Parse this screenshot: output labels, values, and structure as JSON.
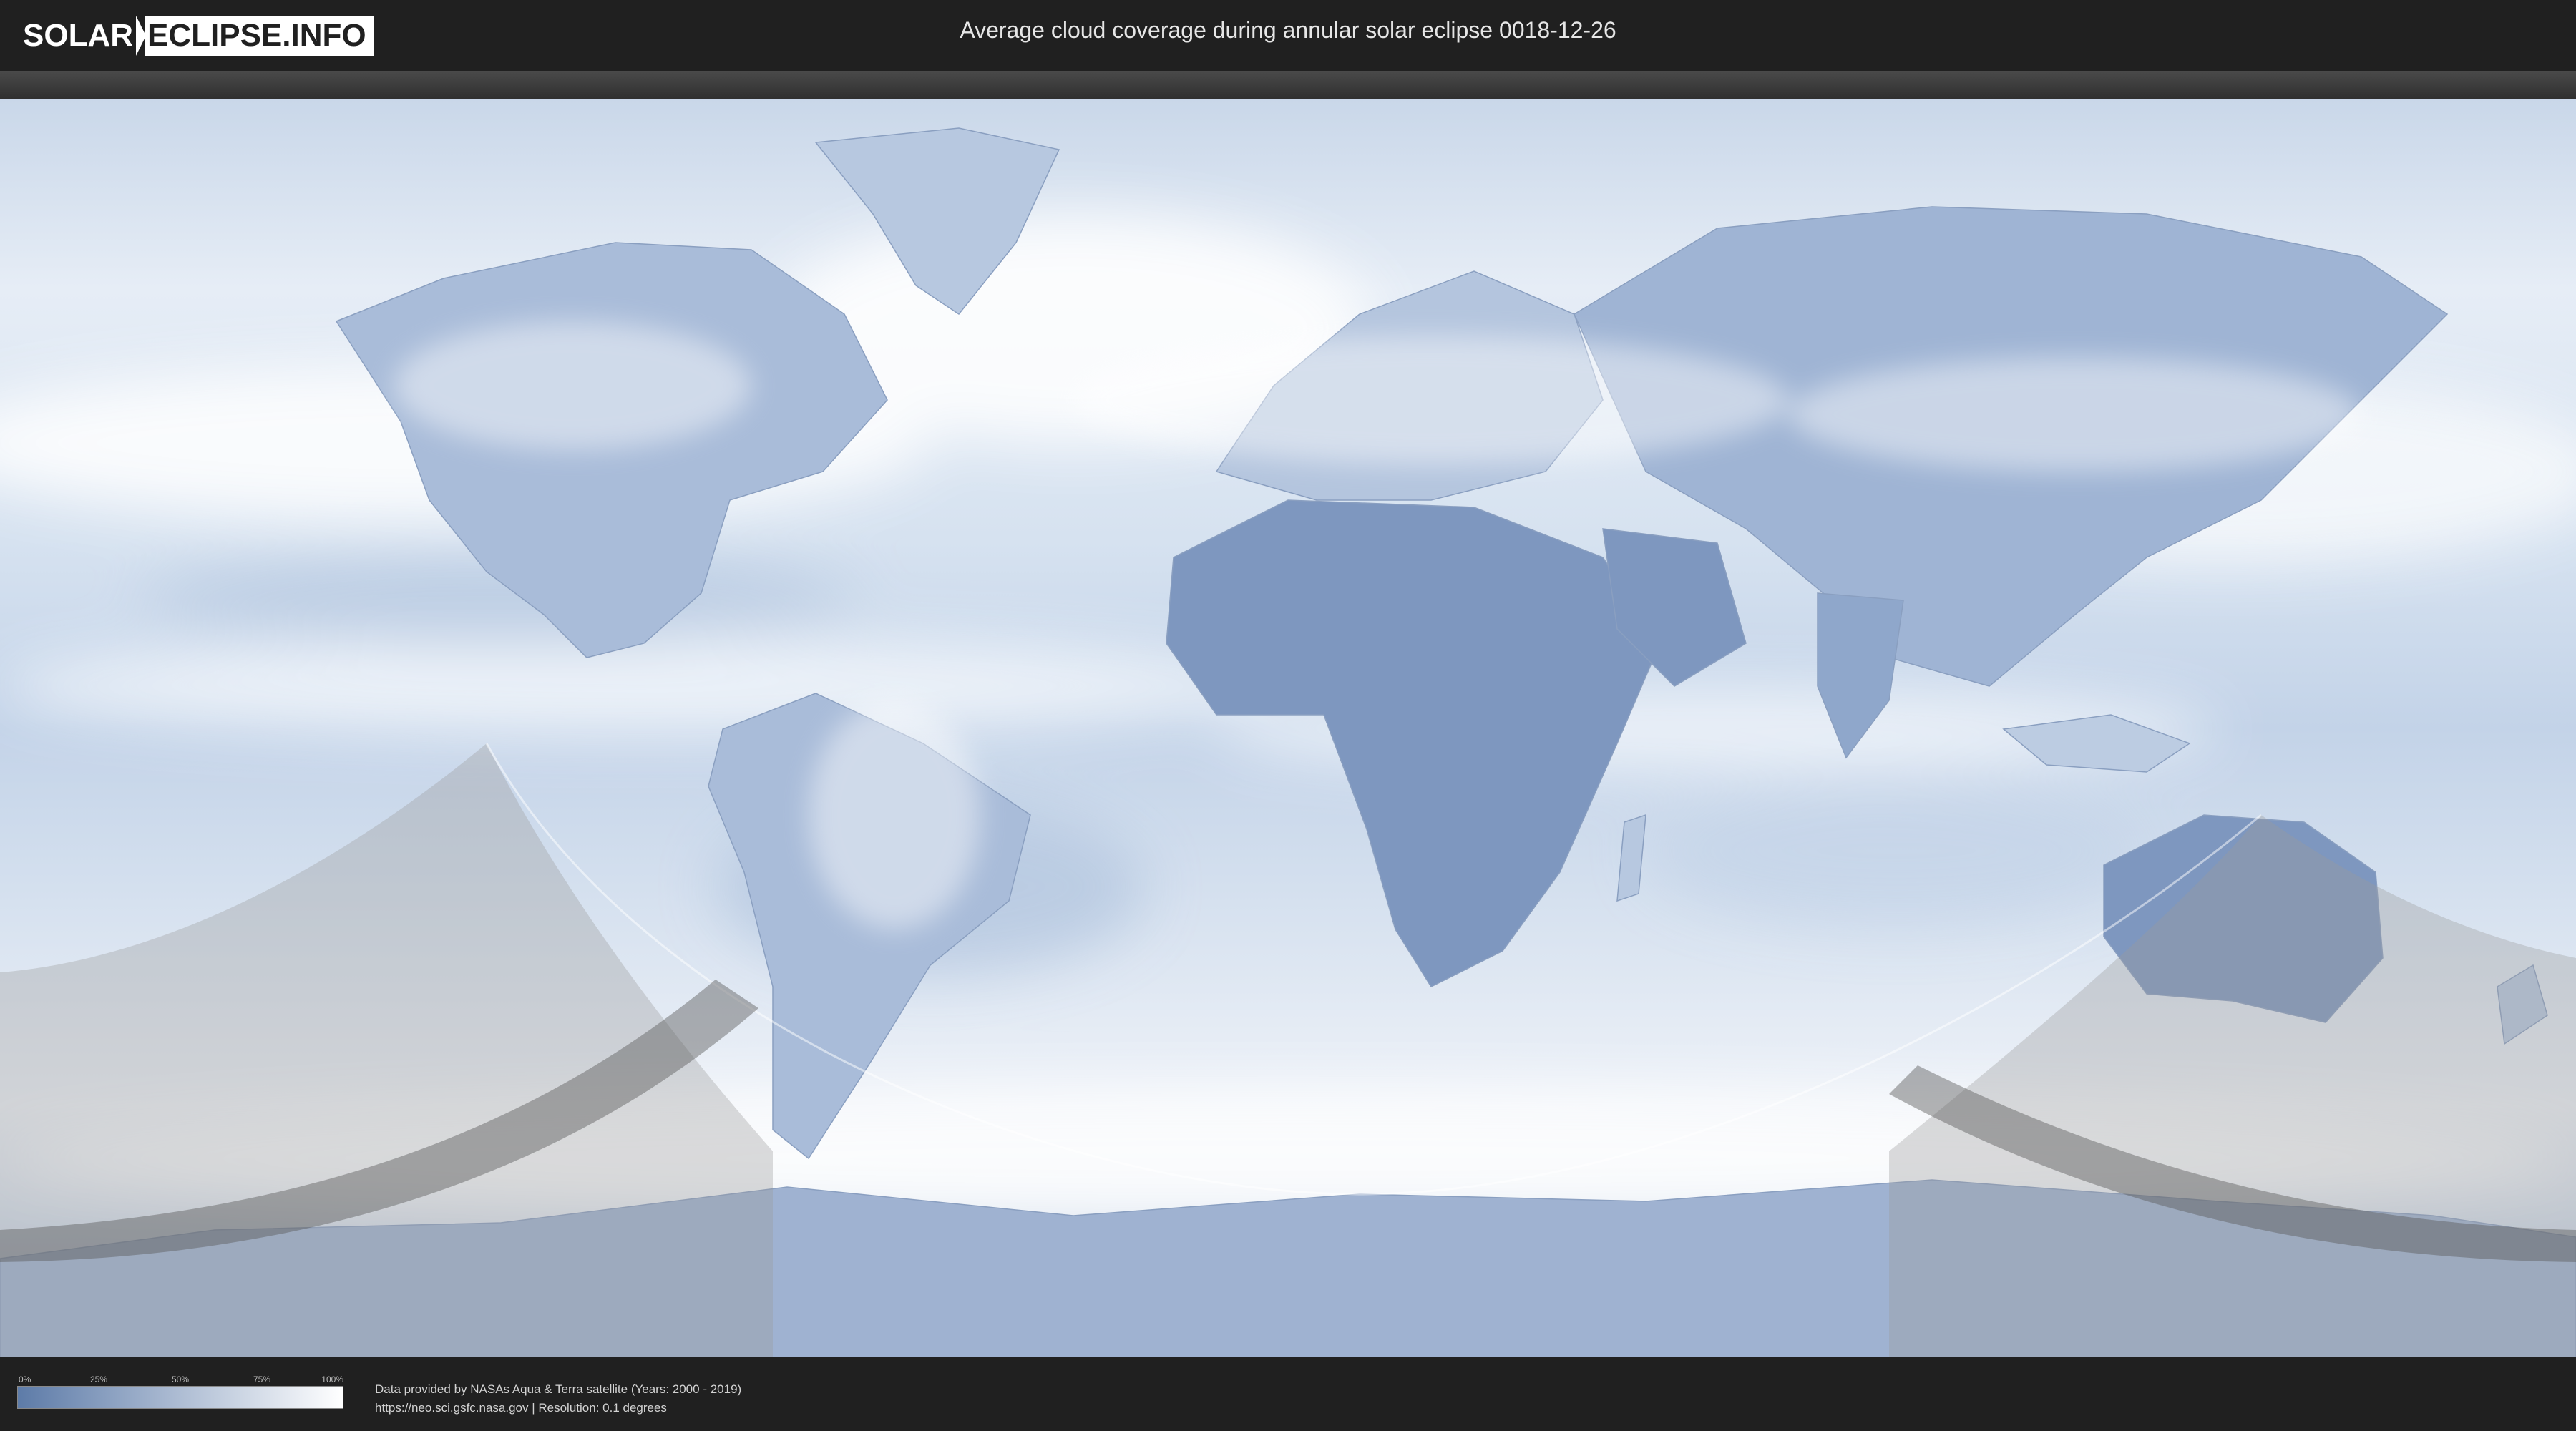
{
  "header": {
    "logo_left": "SOLAR",
    "logo_right": "ECLIPSE.INFO",
    "title": "Average cloud coverage during annular solar eclipse 0018-12-26"
  },
  "legend": {
    "ticks": [
      "0%",
      "25%",
      "50%",
      "75%",
      "100%"
    ],
    "tick_values": [
      0,
      25,
      50,
      75,
      100
    ],
    "color_low": "#5d7ba8",
    "color_high": "#ffffff"
  },
  "credits": {
    "line1": "Data provided by NASAs Aqua & Terra satellite (Years: 2000 - 2019)",
    "line2": "https://neo.sci.gsfc.nasa.gov | Resolution: 0.1 degrees"
  },
  "map": {
    "projection": "equirectangular",
    "ocean_color": "#dce6f2",
    "land_cloudless_color": "#7e97bf",
    "night_overlay_color": "#9a9a9a",
    "eclipse_path_color": "#5a5a5a"
  }
}
